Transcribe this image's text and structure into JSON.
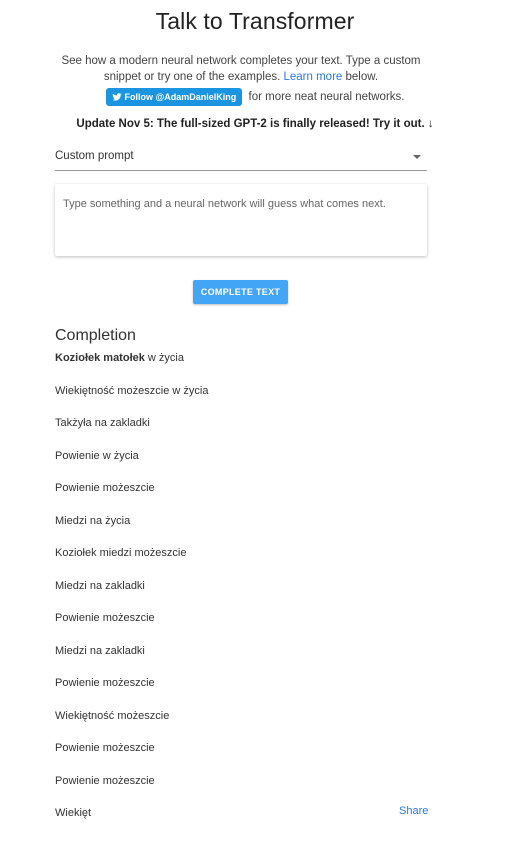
{
  "title": "Talk to Transformer",
  "intro": {
    "text_before": "See how a modern neural network completes your text. Type a custom snippet or try one of the examples. ",
    "link": "Learn more",
    "text_after": " below."
  },
  "follow": {
    "button_label": "Follow @AdamDanielKing",
    "suffix": "for more neat neural networks."
  },
  "update": "Update Nov 5: The full-sized GPT-2 is finally released! Try it out. ↓",
  "prompt_select": {
    "value": "Custom prompt"
  },
  "prompt_input": {
    "placeholder": "Type something and a neural network will guess what comes next."
  },
  "complete_button": "COMPLETE TEXT",
  "completion": {
    "heading": "Completion",
    "first_line": {
      "prompt": "Koziołek matołek",
      "continuation": " w życia"
    },
    "lines": [
      "Wiekiętność możeszcie w życia",
      "Takżyła na zakladki",
      "Powienie w życia",
      "Powienie możeszcie",
      "Miedzi na życia",
      "Koziołek miedzi możeszcie",
      "Miedzi na zakladki",
      "Powienie możeszcie",
      "Miedzi na zakladki",
      "Powienie możeszcie",
      "Wiekiętność możeszcie",
      "Powienie możeszcie",
      "Powienie możeszcie",
      "Wiekięt"
    ],
    "share": "Share"
  }
}
